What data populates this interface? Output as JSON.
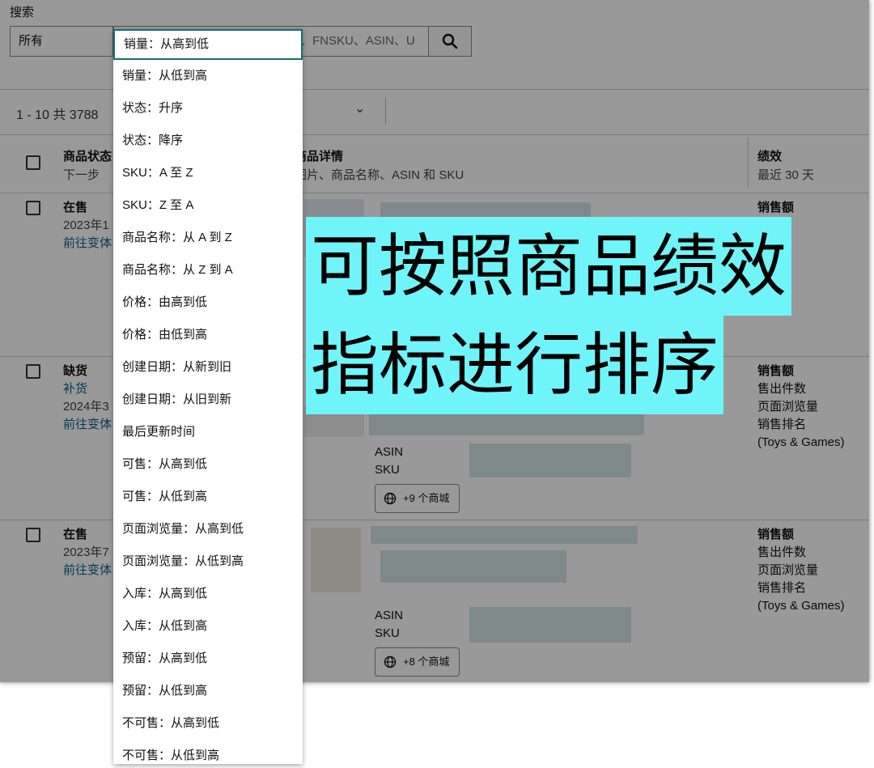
{
  "search": {
    "label": "搜索",
    "scope": "所有",
    "placeholder": "、FNSKU、ASIN、U"
  },
  "toolbar": {
    "pager": "1 - 10 共 3788"
  },
  "table": {
    "headers": {
      "status_title": "商品状态",
      "status_sub": "下一步",
      "details_title": "商品详情",
      "details_sub": "图片、商品名称、ASIN 和 SKU",
      "perf_title": "绩效",
      "perf_sub": "最近 30 天"
    },
    "rows": [
      {
        "status": "在售",
        "date": "2023年1",
        "link": "前往变体",
        "metrics": [
          "销售额"
        ]
      },
      {
        "status": "缺货",
        "action": "补货",
        "date": "2024年3",
        "link": "前往变体",
        "metrics": [
          "销售额",
          "售出件数",
          "页面浏览量",
          "销售排名",
          "(Toys & Games)"
        ],
        "asin_label": "ASIN",
        "sku_label": "SKU",
        "mall_button": "+9 个商城"
      },
      {
        "status": "在售",
        "date": "2023年7",
        "link": "前往变体",
        "metrics": [
          "销售额",
          "售出件数",
          "页面浏览量",
          "销售排名",
          "(Toys & Games)"
        ],
        "asin_label": "ASIN",
        "sku_label": "SKU",
        "mall_button": "+8 个商城"
      }
    ]
  },
  "sort_dropdown": {
    "options": [
      "销量：从高到低",
      "销量：从低到高",
      "状态：升序",
      "状态：降序",
      "SKU：A 至 Z",
      "SKU：Z 至 A",
      "商品名称：从 A 到 Z",
      "商品名称：从 Z 到 A",
      "价格：由高到低",
      "价格：由低到高",
      "创建日期：从新到旧",
      "创建日期：从旧到新",
      "最后更新时间",
      "可售：从高到低",
      "可售：从低到高",
      "页面浏览量：从高到低",
      "页面浏览量：从低到高",
      "入库：从高到低",
      "入库：从低到高",
      "预留：从高到低",
      "预留：从低到高",
      "不可售：从高到低",
      "不可售：从低到高"
    ],
    "selected_index": 0
  },
  "banner": {
    "line1": "可按照商品绩效",
    "line2": "指标进行排序"
  },
  "colors": {
    "banner_bg": "#6ff5f9",
    "selected_border": "#1b6b77",
    "link": "#0a5f8f"
  }
}
